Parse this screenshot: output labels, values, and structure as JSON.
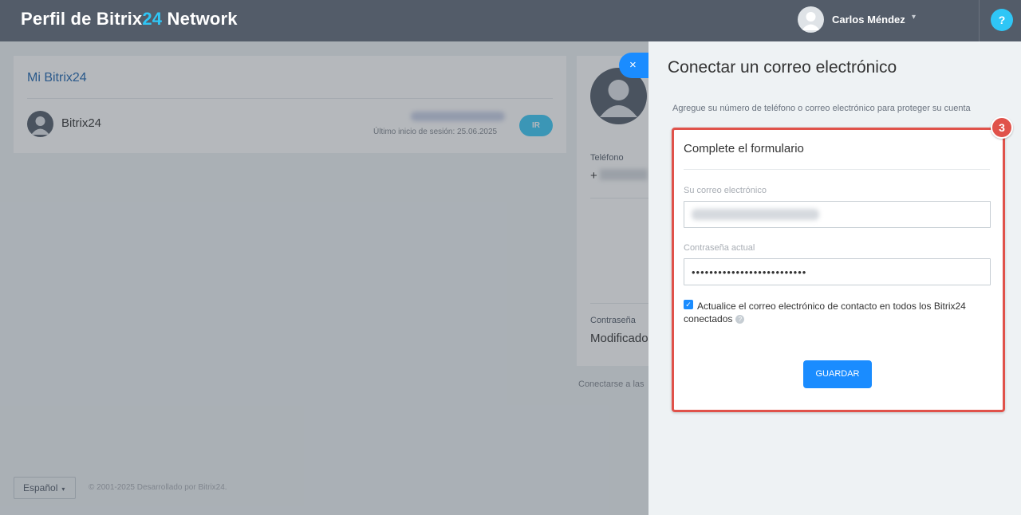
{
  "header": {
    "brand_prefix": "Perfil de Bitrix",
    "brand_accent": "24",
    "brand_suffix": " Network",
    "user_name": "Carlos Méndez",
    "help_label": "?"
  },
  "main": {
    "my_bitrix24": {
      "title": "Mi Bitrix24",
      "portal_name": "Bitrix24",
      "last_login": "Último inicio de sesión: 25.06.2025",
      "go_button": "IR"
    },
    "profile": {
      "phone_label": "Teléfono",
      "phone_prefix": "+",
      "password_label": "Contraseña",
      "password_value": "Modificado"
    },
    "connect_link": "Conectarse a las",
    "language": "Español",
    "copyright": "© 2001-2025 Desarrollado por Bitrix24."
  },
  "slider": {
    "close_label": "×",
    "title": "Conectar un correo electrónico",
    "description": "Agregue su número de teléfono o correo electrónico para proteger su cuenta",
    "step_badge": "3",
    "form": {
      "title": "Complete el formulario",
      "email_label": "Su correo electrónico",
      "email_value": "",
      "password_label": "Contraseña actual",
      "password_value": "••••••••••••••••••••••••••",
      "checkbox_checked": true,
      "checkbox_label": "Actualice el correo electrónico de contacto en todos los Bitrix24 conectados",
      "save_button": "GUARDAR"
    }
  },
  "colors": {
    "header_bg": "#535c69",
    "accent_cyan": "#2fc6f6",
    "primary_blue": "#1a8cff",
    "highlight_red": "#e0524a"
  }
}
